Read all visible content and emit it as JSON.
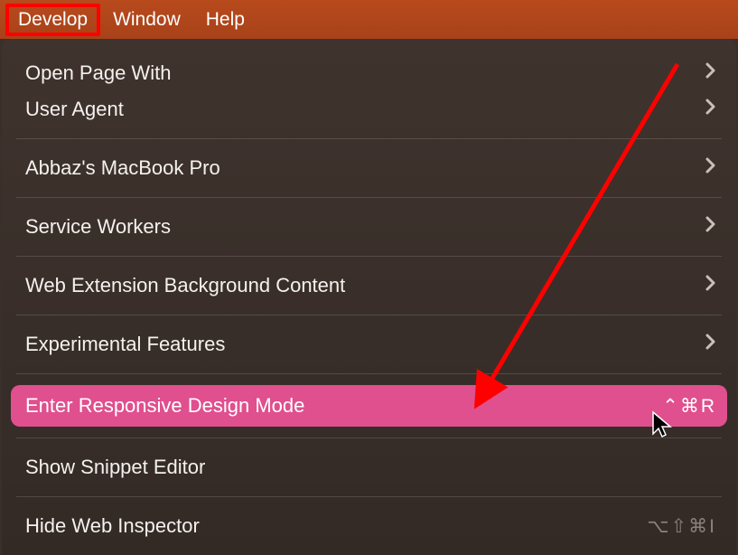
{
  "menubar": {
    "develop": "Develop",
    "window": "Window",
    "help": "Help"
  },
  "menu": {
    "open_page_with": "Open Page With",
    "user_agent": "User Agent",
    "device": "Abbaz's MacBook Pro",
    "service_workers": "Service Workers",
    "web_ext_bg": "Web Extension Background Content",
    "experimental": "Experimental Features",
    "responsive": "Enter Responsive Design Mode",
    "responsive_shortcut": "⌃⌘R",
    "snippet": "Show Snippet Editor",
    "hide_inspector": "Hide Web Inspector",
    "hide_inspector_shortcut": "⌥⇧⌘I"
  }
}
